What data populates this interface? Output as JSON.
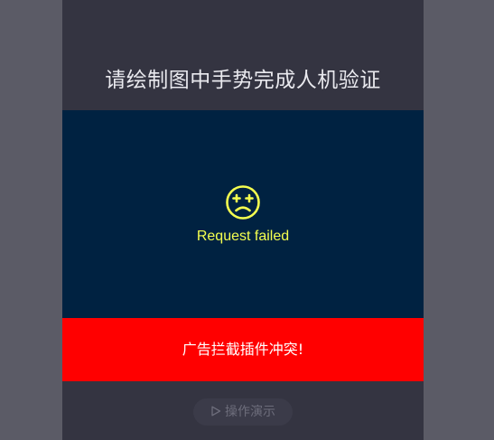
{
  "verification": {
    "title": "请绘制图中手势完成人机验证",
    "status_text": "Request failed",
    "error_message": "广告拦截插件冲突!",
    "demo_button_label": "操作演示"
  },
  "colors": {
    "backdrop": "#5b5b66",
    "panel": "#343441",
    "canvas": "#002241",
    "status_accent": "#f5ff4f",
    "error_banner": "#ff0000"
  },
  "icons": {
    "status": "dizzy-face-icon",
    "demo": "play-icon"
  }
}
